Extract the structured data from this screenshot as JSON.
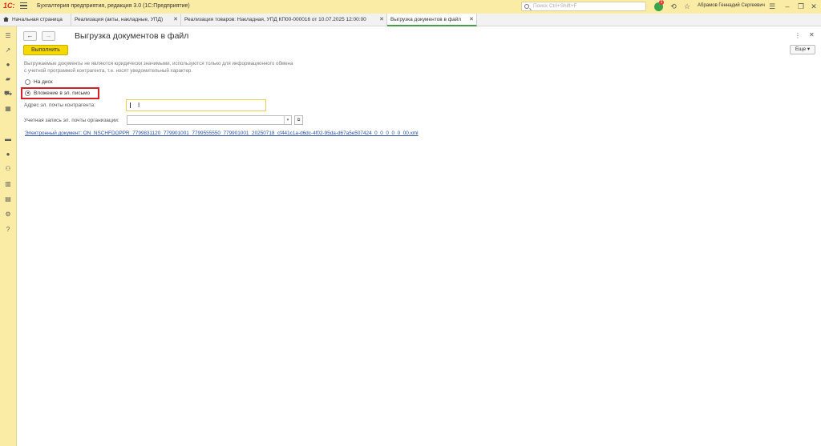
{
  "titlebar": {
    "logo": "1С:",
    "app_title": "Бухгалтерия предприятия, редакция 3.0  (1С:Предприятие)",
    "search_placeholder": "Поиск Ctrl+Shift+F",
    "notification_count": "1",
    "user_name": "Абрамов Геннадий Сергеевич"
  },
  "tabs": [
    {
      "label": "Начальная страница",
      "closable": false
    },
    {
      "label": "Реализация (акты, накладные, УПД)",
      "closable": true
    },
    {
      "label": "Реализация товаров: Накладная, УПД КП00-000016 от 10.07.2025 12:00:00",
      "closable": true
    },
    {
      "label": "Выгрузка документов в файл",
      "closable": true,
      "active": true
    }
  ],
  "form": {
    "title": "Выгрузка документов в файл",
    "execute_label": "Выполнить",
    "more_label": "Еще",
    "info_text": "Выгружаемые документы не являются юридически значимыми, используются только для информационного обмена с учетной программой контрагента, т.е. носят уведомительный характер.",
    "radio_disk": "На диск",
    "radio_email": "Вложение в эл. письмо",
    "selected_option": "Вложение в эл. письмо",
    "email_label": "Адрес эл. почты контрагента:",
    "email_value": "",
    "account_label": "Учетная запись эл. почты организации:",
    "account_value": "",
    "file_link": "Электронный документ: ON_NSCHFDOPPR_7799831120_779901001_7799555550_779901001_20250718_cf441c1a-d6dc-4f02-95da-d67a5e507424_0_0_0_0_0_00.xml"
  },
  "colors": {
    "sidebar_bg": "#fbeca5",
    "execute_button": "#f5d800",
    "highlight_border": "#d0202a",
    "active_tab_underline": "#4c9a4c",
    "link": "#2a4fa3"
  },
  "icons": {
    "sidebar": [
      "menu-icon",
      "trend-icon",
      "coin-icon",
      "bag-icon",
      "cart-icon",
      "grid-icon",
      "truck-icon",
      "person-icon",
      "org-icon",
      "chart-icon",
      "book-icon",
      "gear-icon",
      "help-icon"
    ],
    "titlebar": [
      "search-icon",
      "notification-icon",
      "history-icon",
      "star-icon",
      "settings-icon",
      "minimize-icon",
      "restore-icon",
      "close-icon"
    ]
  }
}
